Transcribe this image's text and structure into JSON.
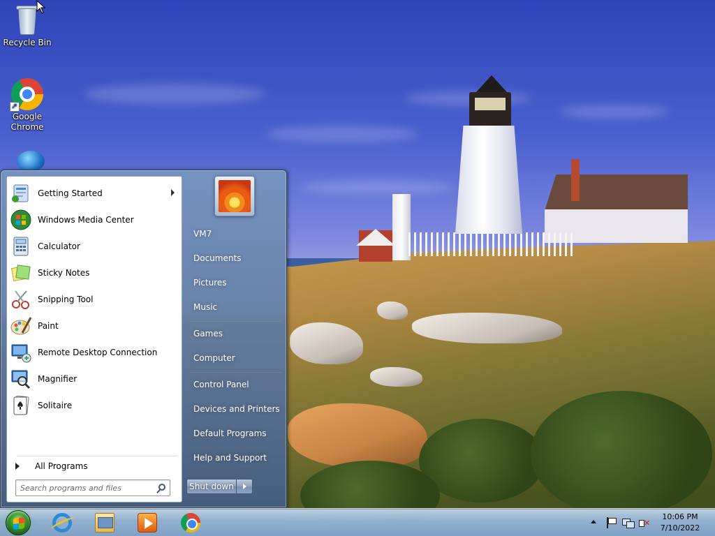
{
  "desktop": {
    "icons": [
      {
        "label": "Recycle Bin",
        "icon": "recycle-bin-icon"
      },
      {
        "label": "Google Chrome",
        "icon": "chrome-icon"
      },
      {
        "label": "",
        "icon": "globe-icon"
      }
    ]
  },
  "start_menu": {
    "programs": [
      {
        "label": "Getting Started",
        "icon": "getting-started-icon",
        "has_submenu": true
      },
      {
        "label": "Windows Media Center",
        "icon": "media-center-icon"
      },
      {
        "label": "Calculator",
        "icon": "calculator-icon"
      },
      {
        "label": "Sticky Notes",
        "icon": "sticky-notes-icon"
      },
      {
        "label": "Snipping Tool",
        "icon": "snipping-tool-icon"
      },
      {
        "label": "Paint",
        "icon": "paint-icon"
      },
      {
        "label": "Remote Desktop Connection",
        "icon": "remote-desktop-icon"
      },
      {
        "label": "Magnifier",
        "icon": "magnifier-icon"
      },
      {
        "label": "Solitaire",
        "icon": "solitaire-icon"
      }
    ],
    "all_programs_label": "All Programs",
    "search": {
      "placeholder": "Search programs and files",
      "value": ""
    },
    "places": [
      "VM7",
      "Documents",
      "Pictures",
      "Music",
      "Games",
      "Computer",
      "Control Panel",
      "Devices and Printers",
      "Default Programs",
      "Help and Support"
    ],
    "shutdown_label": "Shut down"
  },
  "taskbar": {
    "pinned": [
      {
        "icon": "internet-explorer-icon"
      },
      {
        "icon": "windows-explorer-icon"
      },
      {
        "icon": "windows-media-player-icon"
      },
      {
        "icon": "chrome-icon"
      }
    ],
    "clock": {
      "time": "10:06 PM",
      "date": "7/10/2022"
    },
    "tray": [
      "show-hidden-icons",
      "action-center-flag-icon",
      "network-icon",
      "volume-muted-icon"
    ]
  },
  "colors": {
    "menu_frame": "#5f7a9e",
    "programs_bg": "#ffffff",
    "taskbar": "#a9c2de",
    "start_orb": "#3a9a2f"
  }
}
